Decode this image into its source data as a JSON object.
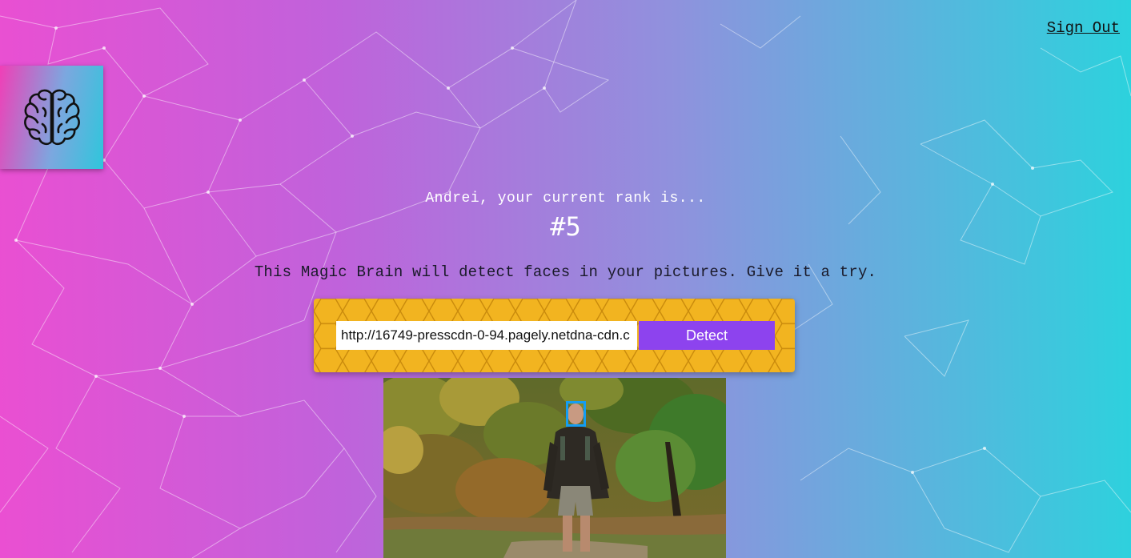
{
  "header": {
    "signout_label": "Sign Out"
  },
  "logo": {
    "icon": "brain-icon"
  },
  "rank": {
    "message": "Andrei, your current rank is...",
    "value": "#5"
  },
  "tagline": "This Magic Brain will detect faces in your pictures. Give it a try.",
  "form": {
    "url_value": "http://16749-presscdn-0-94.pagely.netdna-cdn.c",
    "detect_label": "Detect"
  },
  "result": {
    "image": "hiker-walking-in-forest",
    "face_count": 1
  },
  "colors": {
    "gradient_left": "#ea4fd2",
    "gradient_right": "#2cd2dd",
    "panel_yellow": "#f2b420",
    "button_purple": "#8d43ee",
    "face_box_blue": "#149df2"
  }
}
